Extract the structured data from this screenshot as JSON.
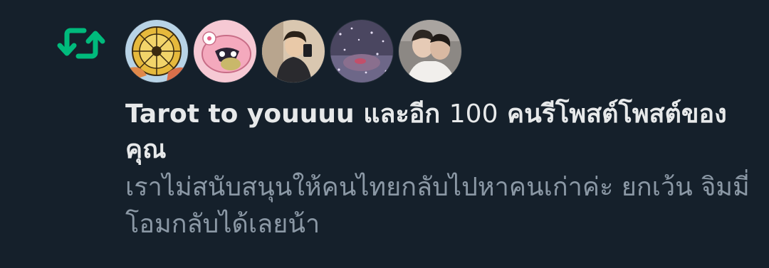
{
  "notification": {
    "type": "retweet",
    "icon": "retweet-icon",
    "icon_color": "#00ba7c",
    "avatars": [
      {
        "name": "tarot-wheel-avatar"
      },
      {
        "name": "pink-cartoon-avatar"
      },
      {
        "name": "selfie-avatar"
      },
      {
        "name": "sparkle-room-avatar"
      },
      {
        "name": "couple-photo-avatar"
      }
    ],
    "actor": "Tarot to youuuu",
    "connector": "และอีก",
    "count": "100",
    "action": "คนรีโพสต์โพสต์ของคุณ",
    "tweet_text": "เราไม่สนับสนุนให้คนไทยกลับไปหาคนเก่าค่ะ ยกเว้น จิมมี่โอมกลับได้เลยน้า"
  },
  "colors": {
    "background": "#15202b",
    "primary_text": "#e7e9ea",
    "secondary_text": "#8b98a5",
    "accent": "#00ba7c"
  }
}
